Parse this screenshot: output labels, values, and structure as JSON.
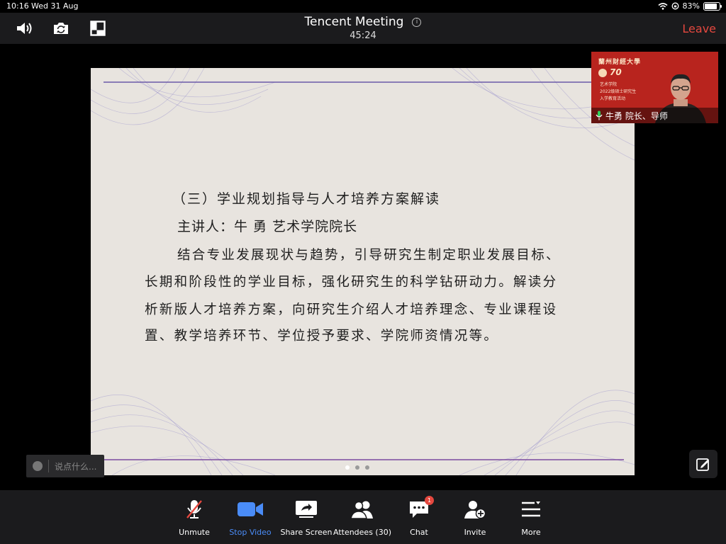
{
  "status_bar": {
    "time": "10:16",
    "date": "Wed 31 Aug",
    "battery": "83%",
    "battery_level": 0.83
  },
  "meeting": {
    "title": "Tencent Meeting",
    "timer": "45:24",
    "leave_label": "Leave"
  },
  "slide": {
    "heading": "（三）学业规划指导与人才培养方案解读",
    "speaker": "主讲人：牛 勇 艺术学院院长",
    "paragraph_lines": [
      "结合专业发展现状与趋势，引导研究生制定职业发展目标、",
      "长期和阶段性的学业目标，强化研究生的科学钻研动力。解读分",
      "析新版人才培养方案，向研究生介绍人才培养理念、专业课程设",
      "置、教学培养环节、学位授予要求、学院师资情况等。"
    ],
    "page_dots": 3,
    "active_page": 1
  },
  "video": {
    "university": "蘭州財經大學",
    "badge_number": "70",
    "lines": [
      "艺术学院",
      "2022级硕士研究生",
      "入学教育活动"
    ],
    "participant_name": "牛勇 院长、导师"
  },
  "chat_input": {
    "placeholder": "说点什么..."
  },
  "toolbar": {
    "items": [
      {
        "label": "Unmute",
        "icon": "mic-muted-icon"
      },
      {
        "label": "Stop Video",
        "icon": "video-camera-icon",
        "active": true
      },
      {
        "label": "Share Screen",
        "icon": "share-screen-icon"
      },
      {
        "label": "Attendees (30)",
        "icon": "attendees-icon"
      },
      {
        "label": "Chat",
        "icon": "chat-icon",
        "badge": "1"
      },
      {
        "label": "Invite",
        "icon": "invite-icon"
      },
      {
        "label": "More",
        "icon": "more-icon"
      }
    ]
  },
  "colors": {
    "accent_blue": "#4a8cf7",
    "leave_red": "#e5483f",
    "toolbar_bg": "#1b1b1d",
    "video_bg": "#b8241e"
  }
}
